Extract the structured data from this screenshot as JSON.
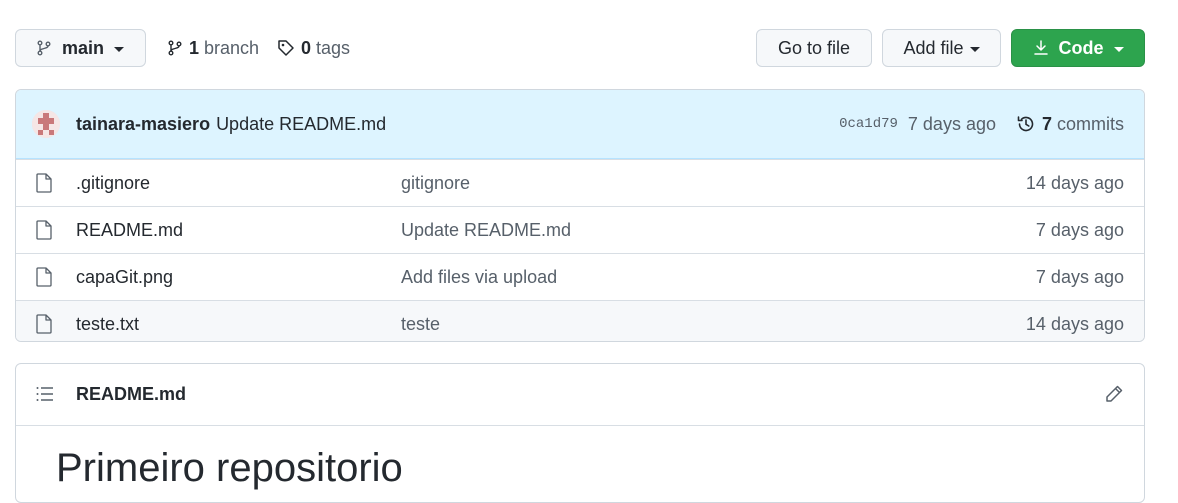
{
  "toolbar": {
    "branch_button": {
      "label": "main",
      "icon": "git-branch-icon"
    },
    "branches": {
      "count": "1",
      "label": "branch",
      "icon": "git-branch-icon"
    },
    "tags": {
      "count": "0",
      "label": "tags",
      "icon": "tag-icon"
    },
    "go_to_file_label": "Go to file",
    "add_file_label": "Add file",
    "code_label": "Code",
    "code_color": "#2da44e"
  },
  "latest_commit": {
    "author": "tainara-masiero",
    "message": "Update README.md",
    "sha": "0ca1d79",
    "age": "7 days ago",
    "commit_count": "7",
    "commits_label": "commits"
  },
  "files": [
    {
      "name": ".gitignore",
      "message": "gitignore",
      "age": "14 days ago"
    },
    {
      "name": "README.md",
      "message": "Update README.md",
      "age": "7 days ago"
    },
    {
      "name": "capaGit.png",
      "message": "Add files via upload",
      "age": "7 days ago"
    },
    {
      "name": "teste.txt",
      "message": "teste",
      "age": "14 days ago"
    }
  ],
  "readme": {
    "file_name": "README.md",
    "heading": "Primeiro repositorio"
  }
}
